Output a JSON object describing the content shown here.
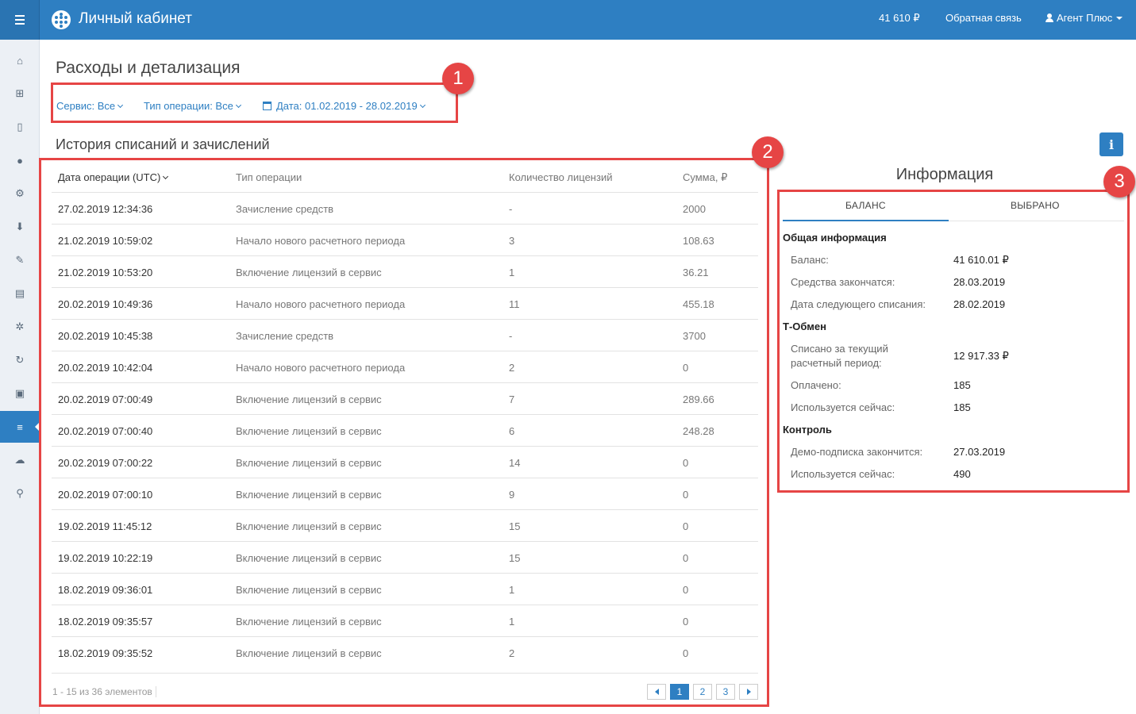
{
  "header": {
    "app_title": "Личный кабинет",
    "balance": "41 610 ₽",
    "feedback": "Обратная связь",
    "user": "Агент Плюс"
  },
  "sidebar": {
    "items": [
      {
        "name": "home-icon",
        "glyph": "⌂"
      },
      {
        "name": "sitemap-icon",
        "glyph": "⊞"
      },
      {
        "name": "mobile-icon",
        "glyph": "▯"
      },
      {
        "name": "globe-icon",
        "glyph": "●"
      },
      {
        "name": "cogs-icon",
        "glyph": "⚙"
      },
      {
        "name": "download-icon",
        "glyph": "⬇"
      },
      {
        "name": "wrench-icon",
        "glyph": "✎"
      },
      {
        "name": "id-card-icon",
        "glyph": "▤"
      },
      {
        "name": "gear-icon",
        "glyph": "✲"
      },
      {
        "name": "refresh-icon",
        "glyph": "↻"
      },
      {
        "name": "money-icon",
        "glyph": "▣"
      },
      {
        "name": "billing-list-icon",
        "glyph": "≡",
        "active": true
      },
      {
        "name": "cloud-upload-icon",
        "glyph": "☁"
      },
      {
        "name": "search-icon",
        "glyph": "⚲"
      }
    ]
  },
  "page": {
    "title": "Расходы и детализация",
    "filters": {
      "service": "Сервис: Все",
      "operation_type": "Тип операции: Все",
      "date": "Дата: 01.02.2019 - 28.02.2019"
    },
    "history_title": "История списаний и зачислений"
  },
  "table": {
    "columns": [
      "Дата операции (UTC)",
      "Тип операции",
      "Количество лицензий",
      "Сумма, ₽"
    ],
    "rows": [
      [
        "27.02.2019 12:34:36",
        "Зачисление средств",
        "-",
        "2000"
      ],
      [
        "21.02.2019 10:59:02",
        "Начало нового расчетного периода",
        "3",
        "108.63"
      ],
      [
        "21.02.2019 10:53:20",
        "Включение лицензий в сервис",
        "1",
        "36.21"
      ],
      [
        "20.02.2019 10:49:36",
        "Начало нового расчетного периода",
        "11",
        "455.18"
      ],
      [
        "20.02.2019 10:45:38",
        "Зачисление средств",
        "-",
        "3700"
      ],
      [
        "20.02.2019 10:42:04",
        "Начало нового расчетного периода",
        "2",
        "0"
      ],
      [
        "20.02.2019 07:00:49",
        "Включение лицензий в сервис",
        "7",
        "289.66"
      ],
      [
        "20.02.2019 07:00:40",
        "Включение лицензий в сервис",
        "6",
        "248.28"
      ],
      [
        "20.02.2019 07:00:22",
        "Включение лицензий в сервис",
        "14",
        "0"
      ],
      [
        "20.02.2019 07:00:10",
        "Включение лицензий в сервис",
        "9",
        "0"
      ],
      [
        "19.02.2019 11:45:12",
        "Включение лицензий в сервис",
        "15",
        "0"
      ],
      [
        "19.02.2019 10:22:19",
        "Включение лицензий в сервис",
        "15",
        "0"
      ],
      [
        "18.02.2019 09:36:01",
        "Включение лицензий в сервис",
        "1",
        "0"
      ],
      [
        "18.02.2019 09:35:57",
        "Включение лицензий в сервис",
        "1",
        "0"
      ],
      [
        "18.02.2019 09:35:52",
        "Включение лицензий в сервис",
        "2",
        "0"
      ]
    ],
    "pager_info": "1 - 15 из 36 элементов",
    "pages": [
      "1",
      "2",
      "3"
    ],
    "current_page": "1"
  },
  "info": {
    "title": "Информация",
    "tabs": [
      "БАЛАНС",
      "ВЫБРАНО"
    ],
    "active_tab": "БАЛАНС",
    "groups": [
      {
        "title": "Общая информация",
        "items": [
          {
            "label": "Баланс:",
            "value": "41 610.01 ₽"
          },
          {
            "label": "Средства закончатся:",
            "value": "28.03.2019"
          },
          {
            "label": "Дата следующего списания:",
            "value": "28.02.2019"
          }
        ]
      },
      {
        "title": "Т-Обмен",
        "items": [
          {
            "label": "Списано за текущий расчетный период:",
            "value": "12 917.33 ₽"
          },
          {
            "label": "Оплачено:",
            "value": "185"
          },
          {
            "label": "Используется сейчас:",
            "value": "185"
          }
        ]
      },
      {
        "title": "Контроль",
        "items": [
          {
            "label": "Демо-подписка закончится:",
            "value": "27.03.2019"
          },
          {
            "label": "Используется сейчас:",
            "value": "490"
          }
        ]
      }
    ]
  },
  "annotations": [
    "1",
    "2",
    "3"
  ],
  "colors": {
    "primary": "#2e7fc2",
    "annotation": "#e64545",
    "sidebar_bg": "#ecf0f5"
  }
}
